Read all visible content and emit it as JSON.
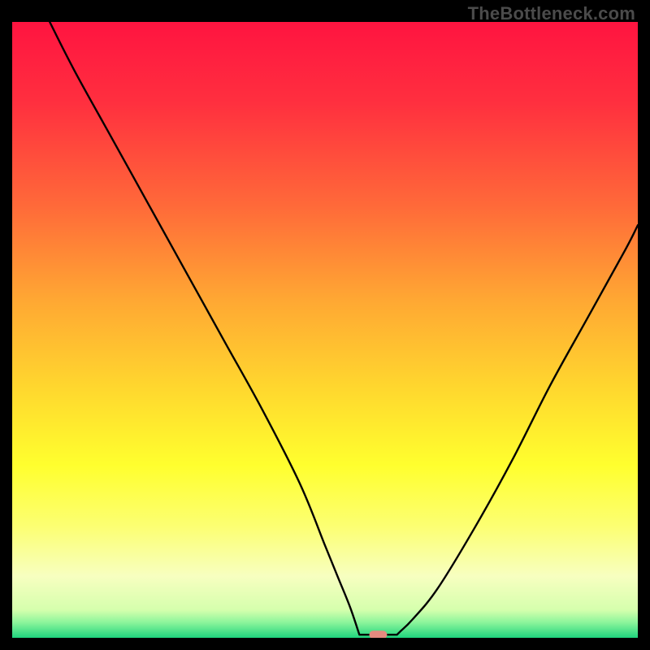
{
  "watermark": "TheBottleneck.com",
  "chart_data": {
    "type": "line",
    "title": "",
    "xlabel": "",
    "ylabel": "",
    "x_range": [
      0,
      100
    ],
    "y_range": [
      0,
      100
    ],
    "gradient_stops": [
      {
        "offset": 0.0,
        "color": "#ff1440"
      },
      {
        "offset": 0.13,
        "color": "#ff2f3f"
      },
      {
        "offset": 0.3,
        "color": "#ff6a39"
      },
      {
        "offset": 0.45,
        "color": "#ffa733"
      },
      {
        "offset": 0.6,
        "color": "#ffd92e"
      },
      {
        "offset": 0.72,
        "color": "#ffff2e"
      },
      {
        "offset": 0.82,
        "color": "#fcff73"
      },
      {
        "offset": 0.9,
        "color": "#f7ffc0"
      },
      {
        "offset": 0.955,
        "color": "#d5ffad"
      },
      {
        "offset": 0.975,
        "color": "#8cf59b"
      },
      {
        "offset": 1.0,
        "color": "#1fd47e"
      }
    ],
    "series": [
      {
        "name": "bottleneck-curve",
        "x": [
          6,
          10,
          16,
          22,
          28,
          34,
          40,
          46,
          50,
          52,
          54,
          56,
          57.5,
          60,
          62,
          64,
          68,
          74,
          80,
          86,
          92,
          98,
          100
        ],
        "values": [
          100,
          92,
          81,
          70,
          59,
          48,
          37,
          25,
          15,
          10,
          5,
          1,
          0.5,
          0.5,
          1,
          3,
          8,
          18,
          29,
          41,
          52,
          63,
          67
        ]
      }
    ],
    "minimum_marker": {
      "x": 58.5,
      "y": 0.5,
      "color": "#e58a7f"
    },
    "flat_bottom_range": [
      55.5,
      61.5
    ]
  }
}
